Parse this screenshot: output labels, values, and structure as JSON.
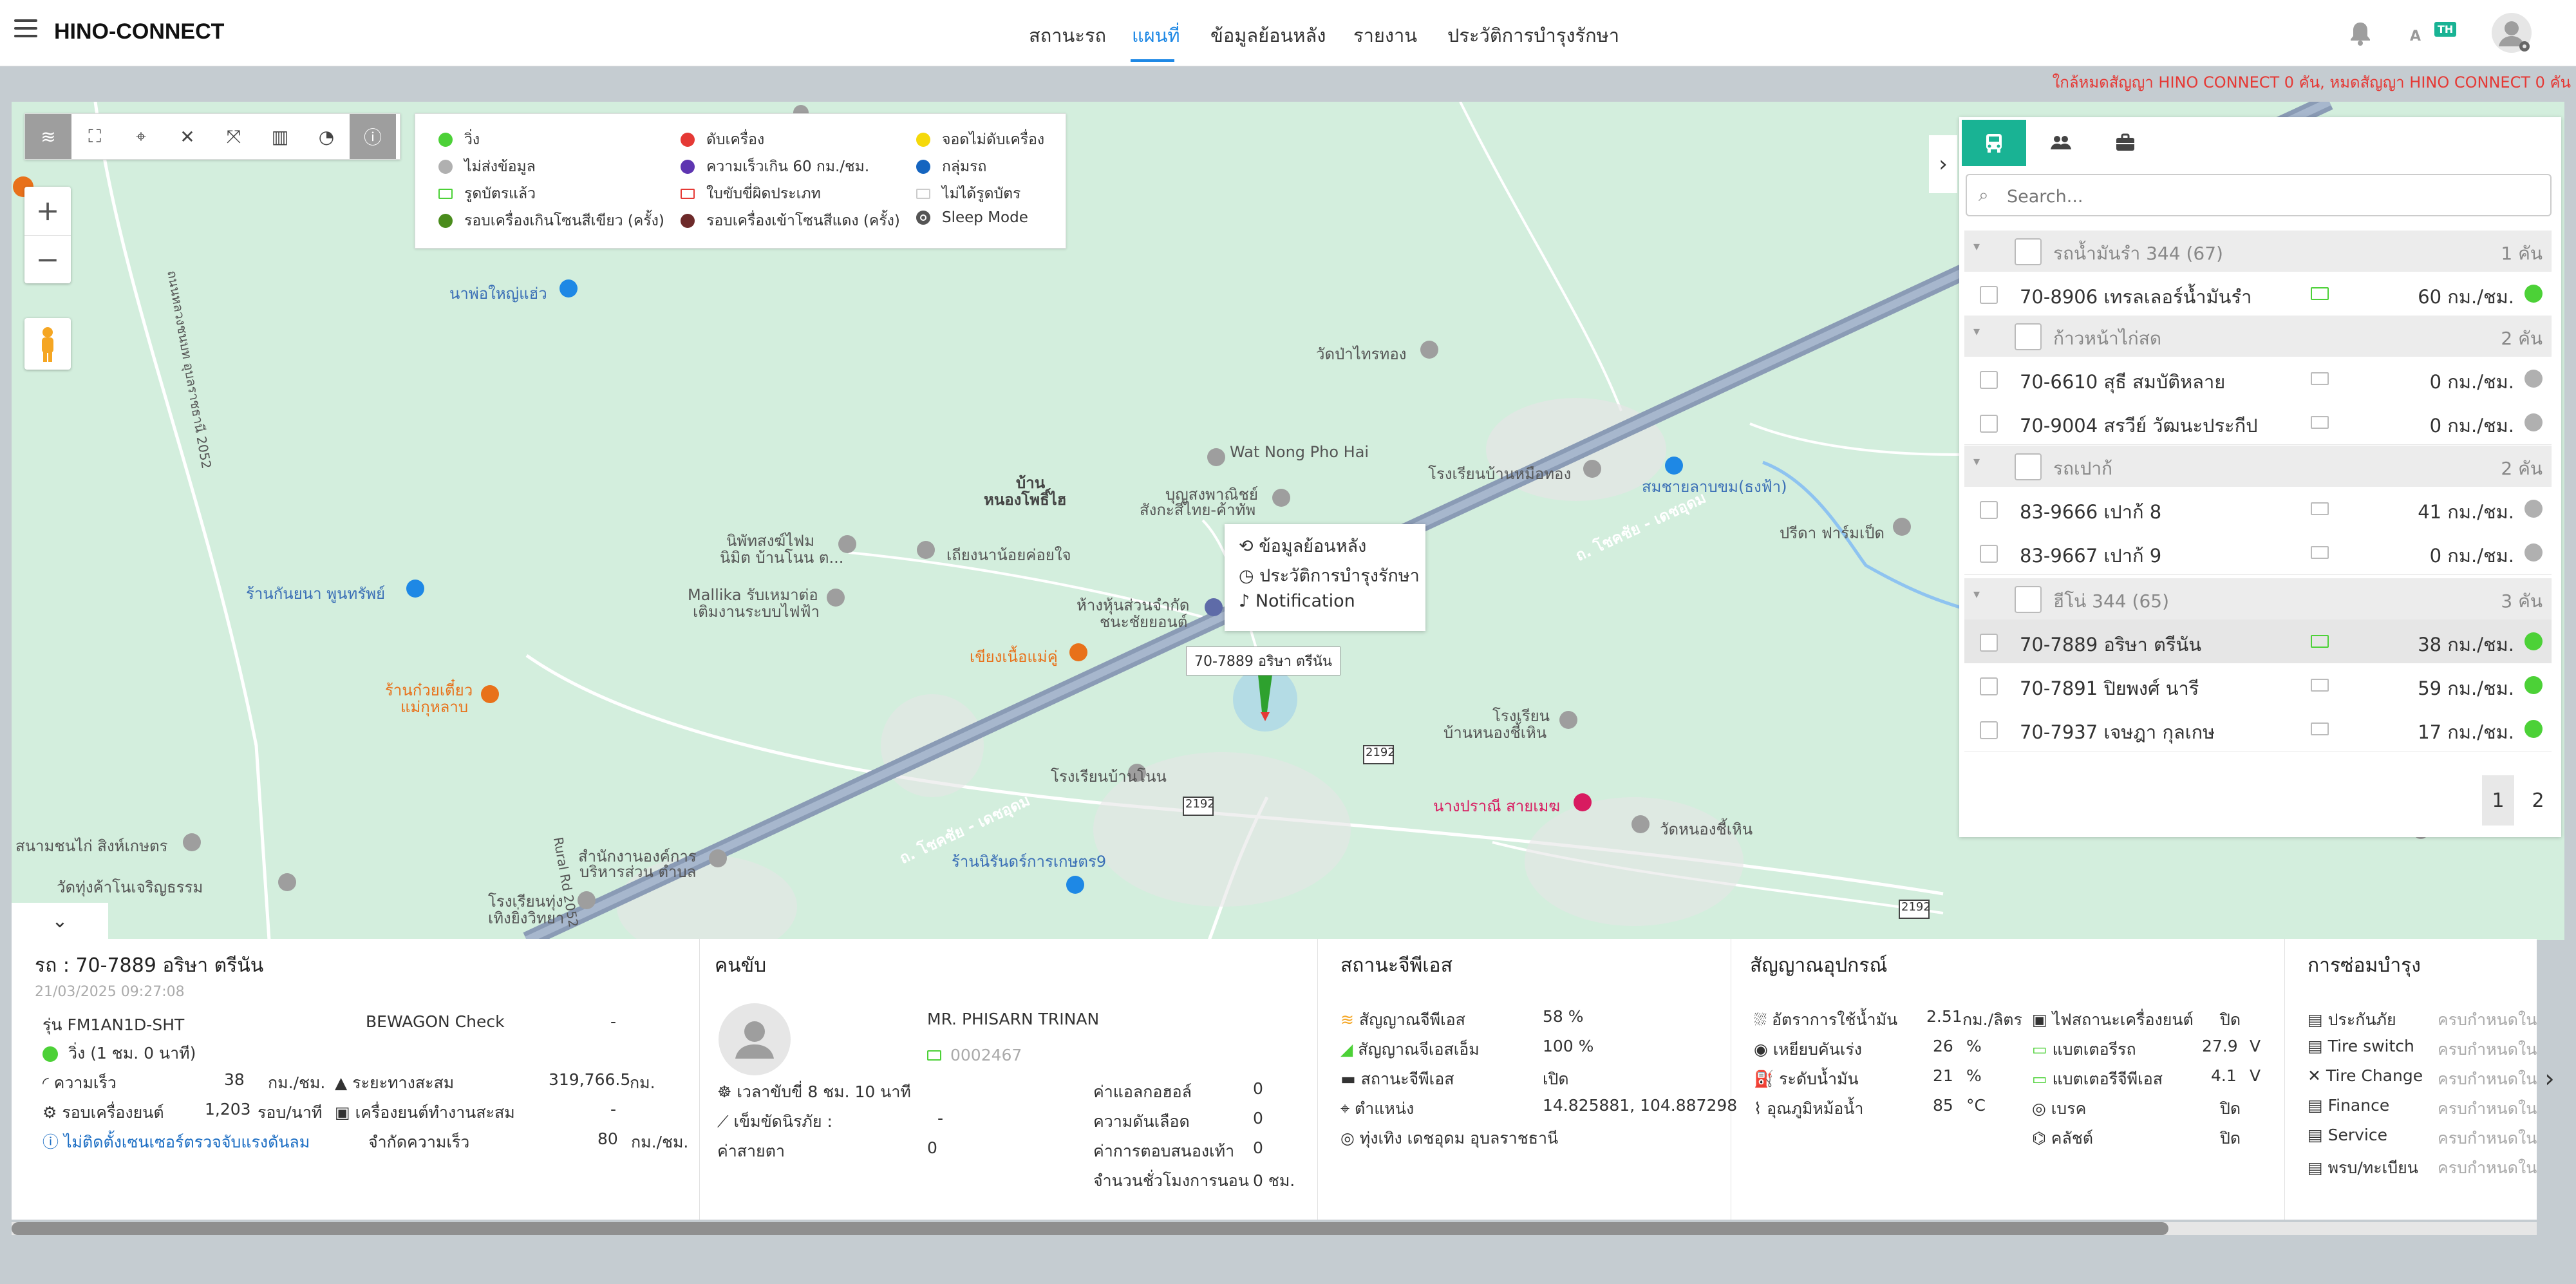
{
  "header": {
    "logo": "HINO-CONNECT",
    "nav": [
      "สถานะรถ",
      "แผนที่",
      "ข้อมูลย้อนหลัง",
      "รายงาน",
      "ประวัติการบำรุงรักษา"
    ],
    "active_nav": "แผนที่",
    "lang_a": "A",
    "lang_badge": "TH",
    "notice": "ใกล้หมดสัญญา HINO CONNECT 0 คัน, หมดสัญญา HINO CONNECT 0 คัน"
  },
  "toolbar": {
    "icons": [
      "layers-icon",
      "fullscreen-icon",
      "location-icon",
      "tools-icon",
      "fit-bounds-icon",
      "map-type-icon",
      "pie-chart-icon",
      "info-icon"
    ]
  },
  "zoom": {
    "in": "+",
    "out": "−"
  },
  "legend": {
    "col1": [
      "วิ่ง",
      "ไม่ส่งข้อมูล",
      "รูดบัตรแล้ว",
      "รอบเครื่องเกินโซนสีเขียว (ครั้ง)"
    ],
    "col2": [
      "ดับเครื่อง",
      "ความเร็วเกิน 60 กม./ชม.",
      "ใบขับขี่ผิดประเภท",
      "รอบเครื่องเข้าโซนสีแดง (ครั้ง)"
    ],
    "col3": [
      "จอดไม่ดับเครื่อง",
      "กลุ่มรถ",
      "ไม่ได้รูดบัตร",
      "Sleep Mode"
    ],
    "colors": {
      "run": "#4cd137",
      "nodata": "#b0b0b0",
      "off": "#e53935",
      "speed": "#5e35b1",
      "idle": "#f5d90a",
      "group": "#1565c0",
      "green_zone": "#4a8c1c",
      "red_zone": "#6d2a2a",
      "swiped": "#4cd137",
      "wrong_license": "#e53935",
      "not_swiped": "#cccccc"
    }
  },
  "map_labels": {
    "l1": "นาพ่อใหญ่แฮ่ว",
    "l2": "วัดป่าไทรทอง",
    "l3": "Wat Nong Pho Hai",
    "l4": "บ้าน",
    "l5": "หนองโพธิ์ไฮ",
    "l6": "บุญสงพาณิชย์",
    "l7": "สังกะสีไทย-ค้าทัพ",
    "l8": "โรงเรียนบ้านหมือทอง",
    "l9": "สมชายลาบขม(ธงฟ้า)",
    "l10": "ปรีดา ฟาร์มเป็ด",
    "l11": "นิพัทสงฆ์ไฟม",
    "l12": "นิมิต บ้านโนน ต...",
    "l13": "เถียงนาน้อยค่อยใจ",
    "l14": "Mallika รับเหมาต่อ",
    "l15": "เติมงานระบบไฟฟ้า",
    "l16": "ร้านกันยนา พูนทรัพย์",
    "l17": "ห้างหุ้นส่วนจำกัด",
    "l18": "ชนะชัยยอนต์",
    "l19": "เขียงเนื้อแม่คู่",
    "l20": "ร้านก๋วยเตี๋ยว",
    "l21": "แม่กุหลาบ",
    "l22": "โรงเรียน",
    "l23": "บ้านหนองชี้เหิน",
    "l24": "โรงเรียนบ้านโนน",
    "l25": "นางปราณี สายเมฆ",
    "l26": "วัดหนองชี้เหิน",
    "l27": "ร้านนิรันดร์การเกษตร9",
    "l28": "สนามชนไก่ สิงห์เกษตร",
    "l29": "วัดทุ่งค้าโนเจริญธรรม",
    "l30": "สำนักงานองค์การ",
    "l31": "บริหารส่วน ตำบล",
    "l32": "โรงเรียนทุ่ง",
    "l33": "เทิงยิ่งวิทยา",
    "road1": "ถ. โชคชัย - เดชอุดม",
    "road2": "ถ. โชคชัย - เดชอุดม",
    "road3": "ถนนหลวงชนบท อุบลราชธานี 2052",
    "road4": "Rural Rd 2052",
    "shield1": "2192",
    "shield2": "2192",
    "shield3": "2192",
    "shield4": "2192"
  },
  "context_menu": {
    "history": "ข้อมูลย้อนหลัง",
    "maintenance": "ประวัติการบำรุงรักษา",
    "notification": "Notification"
  },
  "vehicle_marker_label": "70-7889 อริษา ตรีนัน",
  "panel": {
    "tabs": [
      "vehicle-tab",
      "users-tab",
      "briefcase-tab"
    ],
    "search_placeholder": "Search...",
    "groups": [
      {
        "name": "รถน้ำมันรำ 344 (67)",
        "count": "1 คัน",
        "rows": [
          {
            "name": "70-8906 เทรลเลอร์น้ำมันรำ",
            "speed": "60 กม./ชม.",
            "status": "run",
            "card": "green"
          }
        ]
      },
      {
        "name": "ก้าวหน้าไก่สด",
        "count": "2 คัน",
        "rows": [
          {
            "name": "70-6610 สุธี สมบัติหลาย",
            "speed": "0 กม./ชม.",
            "status": "nodata",
            "card": "grey"
          },
          {
            "name": "70-9004 สรวีย์ วัฒนะประกีป",
            "speed": "0 กม./ชม.",
            "status": "nodata",
            "card": "grey"
          }
        ]
      },
      {
        "name": "รถเปาก้",
        "count": "2 คัน",
        "rows": [
          {
            "name": "83-9666 เปาก้ 8",
            "speed": "41 กม./ชม.",
            "status": "nodata",
            "card": "grey"
          },
          {
            "name": "83-9667 เปาก้ 9",
            "speed": "0 กม./ชม.",
            "status": "nodata",
            "card": "grey"
          }
        ]
      },
      {
        "name": "ฮีโน่ 344 (65)",
        "count": "3 คัน",
        "rows": [
          {
            "name": "70-7889 อริษา ตรีนัน",
            "speed": "38 กม./ชม.",
            "status": "run",
            "card": "green",
            "selected": true
          },
          {
            "name": "70-7891 ปิยพงศ์ นารี",
            "speed": "59 กม./ชม.",
            "status": "run",
            "card": "grey"
          },
          {
            "name": "70-7937 เจษฎา กุลเกษ",
            "speed": "17 กม./ชม.",
            "status": "run",
            "card": "grey"
          }
        ]
      }
    ],
    "pages": [
      "1",
      "2"
    ]
  },
  "vehicle": {
    "title": "รถ : 70-7889 อริษา ตรีนัน",
    "datetime": "21/03/2025 09:27:08",
    "model_label": "รุ่น",
    "model": "FM1AN1D-SHT",
    "bewagon_label": "BEWAGON Check",
    "bewagon": "-",
    "status": "วิ่ง",
    "status_dur": "(1 ชม. 0 นาที)",
    "speed_label": "ความเร็ว",
    "speed": "38",
    "speed_unit": "กม./ชม.",
    "distance_label": "ระยะทางสะสม",
    "distance": "319,766.5",
    "distance_unit": "กม.",
    "rpm_label": "รอบเครื่องยนต์",
    "rpm": "1,203",
    "rpm_unit": "รอบ/นาที",
    "engine_hours_label": "เครื่องยนต์ทำงานสะสม",
    "engine_hours": "-",
    "sensor_warning": "ไม่ติดตั้งเซนเซอร์ตรวจจับแรงดันลม",
    "speed_limit_label": "จำกัดความเร็ว",
    "speed_limit": "80",
    "speed_limit_unit": "กม./ชม."
  },
  "driver": {
    "title": "คนขับ",
    "name": "MR. PHISARN TRINAN",
    "card_no": "0002467",
    "drive_time_label": "เวลาขับขี่",
    "drive_time": "8 ชม. 10 นาที",
    "seatbelt_label": "เข็มขัดนิรภัย :",
    "seatbelt": "-",
    "alcohol_label": "ค่าแอลกอฮอล์",
    "alcohol": "0",
    "bp_label": "ความดันเลือด",
    "bp": "0",
    "response_label": "ค่าการตอบสนองเท้า",
    "response": "0",
    "eye_label": "ค่าสายตา",
    "eye": "0",
    "sleep_label": "จำนวนชั่วโมงการนอน",
    "sleep": "0 ชม."
  },
  "gps": {
    "title": "สถานะจีพีเอส",
    "signal_label": "สัญญาณจีพีเอส",
    "signal": "58 %",
    "gsm_label": "สัญญาณจีเอสเอ็ม",
    "gsm": "100 %",
    "gps_status_label": "สถานะจีพีเอส",
    "gps_status": "เปิด",
    "position_label": "ตำแหน่ง",
    "position": "14.825881, 104.887298",
    "address": "ทุ่งเทิง เดชอุดม อุบลราชธานี"
  },
  "device": {
    "title": "สัญญาณอุปกรณ์",
    "fuel_rate_label": "อัตราการใช้น้ำมัน",
    "fuel_rate": "2.51",
    "fuel_rate_unit": "กม./ลิตร",
    "pedal_label": "เหยียบคันเร่ง",
    "pedal": "26",
    "pedal_unit": "%",
    "fuel_level_label": "ระดับน้ำมัน",
    "fuel_level": "21",
    "fuel_level_unit": "%",
    "coolant_label": "อุณภูมิหม้อน้ำ",
    "coolant": "85",
    "coolant_unit": "°C",
    "engine_light_label": "ไฟสถานะเครื่องยนต์",
    "engine_light": "ปิด",
    "batt_truck_label": "แบตเตอรีรถ",
    "batt_truck": "27.9",
    "batt_truck_unit": "V",
    "batt_gps_label": "แบตเตอรีจีพีเอส",
    "batt_gps": "4.1",
    "batt_gps_unit": "V",
    "brake_label": "เบรค",
    "brake": "ปิด",
    "clutch_label": "คลัชต์",
    "clutch": "ปิด"
  },
  "maintenance": {
    "title": "การซ่อมบำรุง",
    "items": [
      {
        "label": "ประกันภัย",
        "value": "ครบกำหนดใน"
      },
      {
        "label": "Tire switch",
        "value": "ครบกำหนดใน"
      },
      {
        "label": "Tire Change",
        "value": "ครบกำหนดใน"
      },
      {
        "label": "Finance",
        "value": "ครบกำหนดใน"
      },
      {
        "label": "Service",
        "value": "ครบกำหนดใน"
      },
      {
        "label": "พรบ/ทะเบียน",
        "value": "ครบกำหนดใน"
      }
    ]
  }
}
